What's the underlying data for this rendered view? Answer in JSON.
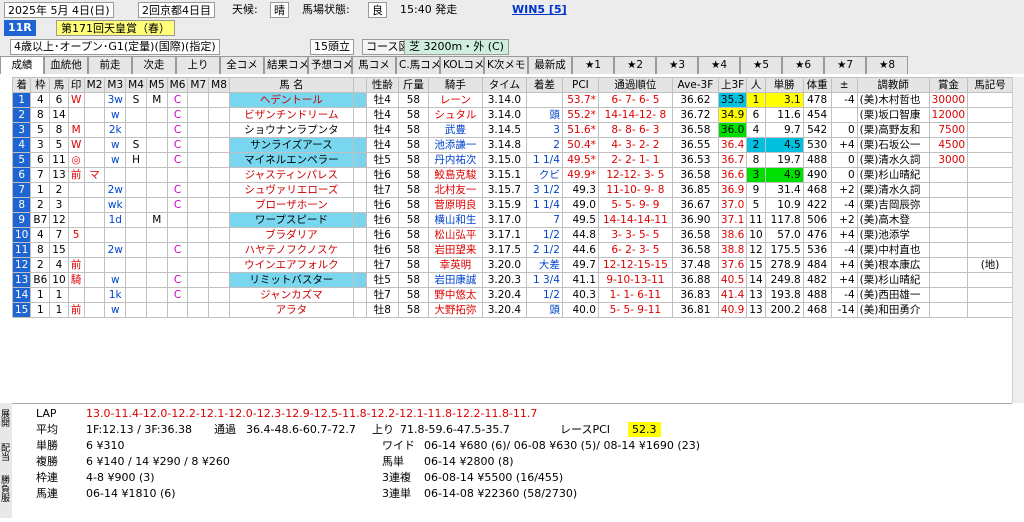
{
  "header": {
    "date": "2025年 5月 4日(日)",
    "meeting": "2回京都4日目",
    "weather_label": "天候:",
    "weather": "晴",
    "track_label": "馬場状態:",
    "track": "良",
    "post_time": "15:40 発走",
    "win5": "WIN5 [5]",
    "race_no": "11R",
    "race_name": "第171回天皇賞（春）",
    "conditions": "4歳以上･オープン･G1(定量)(国際)(指定)",
    "runners": "15頭立",
    "course_map": "コース図",
    "course": "芝 3200m・外 (C)"
  },
  "tabs": [
    "成績",
    "血統他",
    "前走",
    "次走",
    "上り",
    "全コメ",
    "結果コメ",
    "予想コメ",
    "馬コメ",
    "C.馬コメ",
    "KOLコメ",
    "K次メモ",
    "最新成",
    "★1",
    "★2",
    "★3",
    "★4",
    "★5",
    "★6",
    "★7",
    "★8"
  ],
  "columns": [
    "着",
    "枠",
    "馬",
    "印",
    "M2",
    "M3",
    "M4",
    "M5",
    "M6",
    "M7",
    "M8",
    "馬 名",
    "",
    "性齢",
    "斤量",
    "騎手",
    "タイム",
    "着差",
    "PCI",
    "通過順位",
    "Ave-3F",
    "上3F",
    "人",
    "単勝",
    "体重",
    "±",
    "調教師",
    "賞金",
    "馬記号"
  ],
  "rows": [
    {
      "pos": "1",
      "waku": "4",
      "uma": "6",
      "mark": "W",
      "m2": "",
      "m3": "3w",
      "m4": "S",
      "m5": "M",
      "m6": "C",
      "name": "ヘデントール",
      "sex": "牡4",
      "kg": "58",
      "jockey": "レーン",
      "time": "3.14.0",
      "margin": "",
      "pci": "53.7*",
      "pass": "6- 7- 6- 5",
      "ave": "36.62",
      "f3": "35.3",
      "pop": "1",
      "odds": "3.1",
      "wt": "478",
      "diff": "-4",
      "trainer": "(美)木村哲也",
      "prize": "30000",
      "code": "",
      "teal": true,
      "jred": true
    },
    {
      "pos": "2",
      "waku": "8",
      "uma": "14",
      "mark": "",
      "m2": "",
      "m3": "w",
      "m4": "",
      "m5": "",
      "m6": "C",
      "name": "ビザンチンドリーム",
      "sex": "牡4",
      "kg": "58",
      "jockey": "シュタル",
      "time": "3.14.0",
      "margin": "頭",
      "pci": "55.2*",
      "pass": "14-14-12- 8",
      "ave": "36.72",
      "f3": "34.9",
      "pop": "6",
      "odds": "11.6",
      "wt": "454",
      "diff": "",
      "trainer": "(栗)坂口智康",
      "prize": "12000",
      "code": "",
      "teal": false,
      "jred": true
    },
    {
      "pos": "3",
      "waku": "5",
      "uma": "8",
      "mark": "M",
      "m2": "",
      "m3": "2k",
      "m4": "",
      "m5": "",
      "m6": "C",
      "name": "ショウナンラプンタ",
      "sex": "牡4",
      "kg": "58",
      "jockey": "武豊",
      "time": "3.14.5",
      "margin": "3",
      "pci": "51.6*",
      "pass": "8- 8- 6- 3",
      "ave": "36.58",
      "f3": "36.0",
      "pop": "4",
      "odds": "9.7",
      "wt": "542",
      "diff": "0",
      "trainer": "(栗)高野友和",
      "prize": "7500",
      "code": "",
      "teal": false,
      "jred": false
    },
    {
      "pos": "4",
      "waku": "3",
      "uma": "5",
      "mark": "W",
      "m2": "",
      "m3": "w",
      "m4": "S",
      "m5": "",
      "m6": "C",
      "name": "サンライズアース",
      "sex": "牡4",
      "kg": "58",
      "jockey": "池添謙一",
      "time": "3.14.8",
      "margin": "2",
      "pci": "50.4*",
      "pass": "4- 3- 2- 2",
      "ave": "36.55",
      "f3": "36.4",
      "pop": "2",
      "odds": "4.5",
      "wt": "530",
      "diff": "+4",
      "trainer": "(栗)石坂公一",
      "prize": "4500",
      "code": "",
      "teal": true,
      "jred": false
    },
    {
      "pos": "5",
      "waku": "6",
      "uma": "11",
      "mark": "◎",
      "m2": "",
      "m3": "w",
      "m4": "H",
      "m5": "",
      "m6": "C",
      "name": "マイネルエンペラー",
      "sex": "牡5",
      "kg": "58",
      "jockey": "丹内祐次",
      "time": "3.15.0",
      "margin": "1 1/4",
      "pci": "49.5*",
      "pass": "2- 2- 1- 1",
      "ave": "36.53",
      "f3": "36.7",
      "pop": "8",
      "odds": "19.7",
      "wt": "488",
      "diff": "0",
      "trainer": "(栗)清水久詞",
      "prize": "3000",
      "code": "",
      "teal": true,
      "jred": false
    },
    {
      "pos": "6",
      "waku": "7",
      "uma": "13",
      "mark": "前",
      "m2": "マ",
      "m3": "",
      "m4": "",
      "m5": "",
      "m6": "",
      "name": "ジャスティンパレス",
      "sex": "牡6",
      "kg": "58",
      "jockey": "鮫島克駿",
      "time": "3.15.1",
      "margin": "クビ",
      "pci": "49.9*",
      "pass": "12-12- 3- 5",
      "ave": "36.58",
      "f3": "36.6",
      "pop": "3",
      "odds": "4.9",
      "wt": "490",
      "diff": "0",
      "trainer": "(栗)杉山晴紀",
      "prize": "",
      "code": "",
      "teal": false,
      "jred": true
    },
    {
      "pos": "7",
      "waku": "1",
      "uma": "2",
      "mark": "",
      "m2": "",
      "m3": "2w",
      "m4": "",
      "m5": "",
      "m6": "C",
      "name": "シュヴァリエローズ",
      "sex": "牡7",
      "kg": "58",
      "jockey": "北村友一",
      "time": "3.15.7",
      "margin": "3 1/2",
      "pci": "49.3",
      "pass": "11-10- 9- 8",
      "ave": "36.85",
      "f3": "36.9",
      "pop": "9",
      "odds": "31.4",
      "wt": "468",
      "diff": "+2",
      "trainer": "(栗)清水久詞",
      "prize": "",
      "code": "",
      "teal": false,
      "jred": true
    },
    {
      "pos": "8",
      "waku": "2",
      "uma": "3",
      "mark": "",
      "m2": "",
      "m3": "wk",
      "m4": "",
      "m5": "",
      "m6": "C",
      "name": "ブローザホーン",
      "sex": "牡6",
      "kg": "58",
      "jockey": "菅原明良",
      "time": "3.15.9",
      "margin": "1 1/4",
      "pci": "49.0",
      "pass": "5- 5- 9- 9",
      "ave": "36.67",
      "f3": "37.0",
      "pop": "5",
      "odds": "10.9",
      "wt": "422",
      "diff": "-4",
      "trainer": "(栗)吉岡辰弥",
      "prize": "",
      "code": "",
      "teal": false,
      "jred": true
    },
    {
      "pos": "9",
      "waku": "B7",
      "uma": "12",
      "mark": "",
      "m2": "",
      "m3": "1d",
      "m4": "",
      "m5": "M",
      "m6": "",
      "name": "ワープスピード",
      "sex": "牡6",
      "kg": "58",
      "jockey": "横山和生",
      "time": "3.17.0",
      "margin": "7",
      "pci": "49.5",
      "pass": "14-14-14-11",
      "ave": "36.90",
      "f3": "37.1",
      "pop": "11",
      "odds": "117.8",
      "wt": "506",
      "diff": "+2",
      "trainer": "(美)高木登",
      "prize": "",
      "code": "",
      "teal": true,
      "jred": false
    },
    {
      "pos": "10",
      "waku": "4",
      "uma": "7",
      "mark": "5",
      "m2": "",
      "m3": "",
      "m4": "",
      "m5": "",
      "m6": "",
      "name": "ブラダリア",
      "sex": "牡6",
      "kg": "58",
      "jockey": "松山弘平",
      "time": "3.17.1",
      "margin": "1/2",
      "pci": "44.8",
      "pass": "3- 3- 5- 5",
      "ave": "36.58",
      "f3": "38.6",
      "pop": "10",
      "odds": "57.0",
      "wt": "476",
      "diff": "+4",
      "trainer": "(栗)池添学",
      "prize": "",
      "code": "",
      "teal": false,
      "jred": true
    },
    {
      "pos": "11",
      "waku": "8",
      "uma": "15",
      "mark": "",
      "m2": "",
      "m3": "2w",
      "m4": "",
      "m5": "",
      "m6": "C",
      "name": "ハヤテノフクノスケ",
      "sex": "牡6",
      "kg": "58",
      "jockey": "岩田望来",
      "time": "3.17.5",
      "margin": "2 1/2",
      "pci": "44.6",
      "pass": "6- 2- 3- 5",
      "ave": "36.58",
      "f3": "38.8",
      "pop": "12",
      "odds": "175.5",
      "wt": "536",
      "diff": "-4",
      "trainer": "(栗)中村直也",
      "prize": "",
      "code": "",
      "teal": false,
      "jred": true
    },
    {
      "pos": "12",
      "waku": "2",
      "uma": "4",
      "mark": "前",
      "m2": "",
      "m3": "",
      "m4": "",
      "m5": "",
      "m6": "",
      "name": "ウインエアフォルク",
      "sex": "牡7",
      "kg": "58",
      "jockey": "幸英明",
      "time": "3.20.0",
      "margin": "大差",
      "pci": "49.7",
      "pass": "12-12-15-15",
      "ave": "37.48",
      "f3": "37.6",
      "pop": "15",
      "odds": "278.9",
      "wt": "484",
      "diff": "+4",
      "trainer": "(美)根本康広",
      "prize": "",
      "code": "(地)",
      "teal": false,
      "jred": true
    },
    {
      "pos": "13",
      "waku": "B6",
      "uma": "10",
      "mark": "騎",
      "m2": "",
      "m3": "w",
      "m4": "",
      "m5": "",
      "m6": "C",
      "name": "リミットバスター",
      "sex": "牡5",
      "kg": "58",
      "jockey": "岩田康誠",
      "time": "3.20.3",
      "margin": "1 3/4",
      "pci": "41.1",
      "pass": "9-10-13-11",
      "ave": "36.88",
      "f3": "40.5",
      "pop": "14",
      "odds": "249.8",
      "wt": "482",
      "diff": "+4",
      "trainer": "(栗)杉山晴紀",
      "prize": "",
      "code": "",
      "teal": true,
      "jred": false
    },
    {
      "pos": "14",
      "waku": "1",
      "uma": "1",
      "mark": "",
      "m2": "",
      "m3": "1k",
      "m4": "",
      "m5": "",
      "m6": "C",
      "name": "ジャンカズマ",
      "sex": "牡7",
      "kg": "58",
      "jockey": "野中悠太",
      "time": "3.20.4",
      "margin": "1/2",
      "pci": "40.3",
      "pass": "1- 1- 6-11",
      "ave": "36.83",
      "f3": "41.4",
      "pop": "13",
      "odds": "193.8",
      "wt": "488",
      "diff": "-4",
      "trainer": "(美)西田雄一",
      "prize": "",
      "code": "",
      "teal": false,
      "jred": true
    },
    {
      "pos": "15",
      "waku": "1",
      "uma": "1",
      "mark": "前",
      "m2": "",
      "m3": "w",
      "m4": "",
      "m5": "",
      "m6": "",
      "name": "アラタ",
      "sex": "牡8",
      "kg": "58",
      "jockey": "大野拓弥",
      "time": "3.20.4",
      "margin": "頭",
      "pci": "40.0",
      "pass": "5- 5- 9-11",
      "ave": "36.81",
      "f3": "40.9",
      "pop": "13",
      "odds": "200.2",
      "wt": "468",
      "diff": "-14",
      "trainer": "(美)和田勇介",
      "prize": "",
      "code": "",
      "teal": false,
      "jred": true
    }
  ],
  "bottom": {
    "vtabs": [
      "展開",
      "配当",
      "勝負服"
    ],
    "lap_label": "LAP",
    "lap": "13.0-11.4-12.0-12.2-12.1-12.0-12.3-12.9-12.5-11.8-12.2-12.1-11.8-12.2-11.8-11.7",
    "avg_label": "平均",
    "avg": "1F:12.13 / 3F:36.38",
    "pass_label": "通過",
    "pass": "36.4-48.6-60.7-72.7",
    "agari_label": "上り",
    "agari": "71.8-59.6-47.5-35.7",
    "rpci_label": "レースPCI",
    "rpci": "52.3",
    "tansho_label": "単勝",
    "tansho": "6 ¥310",
    "fukusho_label": "複勝",
    "fukusho": "6 ¥140 / 14 ¥290 / 8 ¥260",
    "wakuren_label": "枠連",
    "wakuren": "4-8 ¥900 (3)",
    "umaren_label": "馬連",
    "umaren": "06-14 ¥1810 (6)",
    "wide_label": "ワイド",
    "wide": "06-14 ¥680 (6)/ 06-08 ¥630 (5)/ 08-14 ¥1690 (23)",
    "umatan_label": "馬単",
    "umatan": "06-14 ¥2800 (8)",
    "sanrenpuku_label": "3連複",
    "sanrenpuku": "06-08-14 ¥5500 (16/455)",
    "sanrentan_label": "3連単",
    "sanrentan": "06-14-08 ¥22360 (58/2730)"
  }
}
